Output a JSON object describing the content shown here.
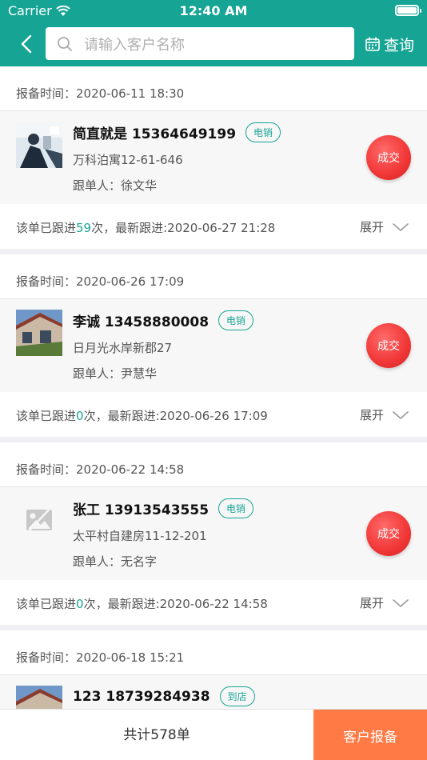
{
  "status_bar": {
    "carrier": "Carrier",
    "time": "12:40 AM"
  },
  "header": {
    "search_placeholder": "请输入客户名称",
    "query_label": "查询"
  },
  "records": [
    {
      "report_time": "报备时间：2020-06-11 18:30",
      "name_phone": "简直就是 15364649199",
      "tag": "电销",
      "address": "万科泊寓12-61-646",
      "follower": "跟单人：徐文华",
      "deal_label": "成交",
      "follow_prefix": "该单已跟进",
      "follow_count": "59",
      "follow_suffix": "次，最新跟进:2020-06-27 21:28",
      "expand_label": "展开",
      "thumb": "lab-photo"
    },
    {
      "report_time": "报备时间：2020-06-26 17:09",
      "name_phone": "李诚 13458880008",
      "tag": "电销",
      "address": "日月光水岸新郡27",
      "follower": "跟单人：尹慧华",
      "deal_label": "成交",
      "follow_prefix": "该单已跟进",
      "follow_count": "0",
      "follow_suffix": "次，最新跟进:2020-06-26 17:09",
      "expand_label": "展开",
      "thumb": "house-photo"
    },
    {
      "report_time": "报备时间：2020-06-22 14:58",
      "name_phone": "张工 13913543555",
      "tag": "电销",
      "address": "太平村自建房11-12-201",
      "follower": "跟单人：无名字",
      "deal_label": "成交",
      "follow_prefix": "该单已跟进",
      "follow_count": "0",
      "follow_suffix": "次，最新跟进:2020-06-22 14:58",
      "expand_label": "展开",
      "thumb": "placeholder-image-icon"
    },
    {
      "report_time": "报备时间：2020-06-18 15:21",
      "name_phone": "123 18739284938",
      "tag": "到店",
      "thumb": "house-photo"
    }
  ],
  "footer": {
    "total": "共计578单",
    "report_button": "客户报备"
  },
  "colors": {
    "primary": "#16a594",
    "deal_red": "#f23a3a",
    "report_orange": "#ff7a45"
  }
}
